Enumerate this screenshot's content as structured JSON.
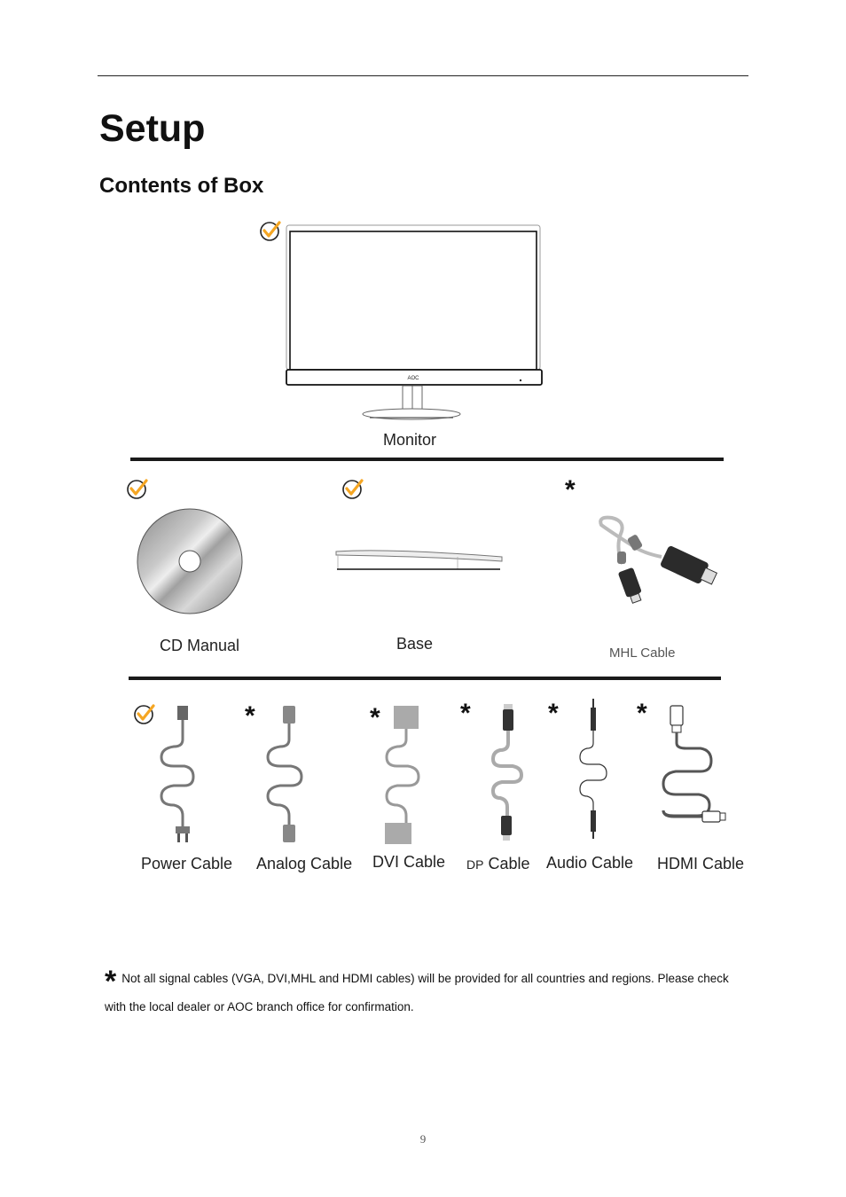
{
  "page": {
    "title": "Setup",
    "section_title": "Contents of Box",
    "page_number": "9"
  },
  "legend": {
    "check_icon": "check-circle-icon",
    "check_meaning": "included",
    "star_icon": "asterisk",
    "star_symbol": "*",
    "accent_color": "#f5a623"
  },
  "items": {
    "monitor": {
      "label": "Monitor",
      "marker": "check"
    },
    "cd_manual": {
      "label": "CD Manual",
      "marker": "check"
    },
    "base": {
      "label": "Base",
      "marker": "check"
    },
    "mhl_cable": {
      "label": "MHL Cable",
      "marker": "star"
    },
    "power_cable": {
      "label": "Power Cable",
      "marker": "check"
    },
    "analog_cable": {
      "label": "Analog Cable",
      "marker": "star"
    },
    "dvi_cable": {
      "label": "DVI  Cable",
      "marker": "star"
    },
    "dp_cable": {
      "prefix": "DP",
      "label": "Cable",
      "marker": "star"
    },
    "audio_cable": {
      "label": "Audio  Cable",
      "marker": "star"
    },
    "hdmi_cable": {
      "label": "HDMI  Cable",
      "marker": "star"
    }
  },
  "footnote": {
    "symbol": "*",
    "text": "Not all signal cables (VGA, DVI,MHL and HDMI cables) will be provided for all countries and regions. Please check with the local dealer or AOC branch office for confirmation."
  }
}
